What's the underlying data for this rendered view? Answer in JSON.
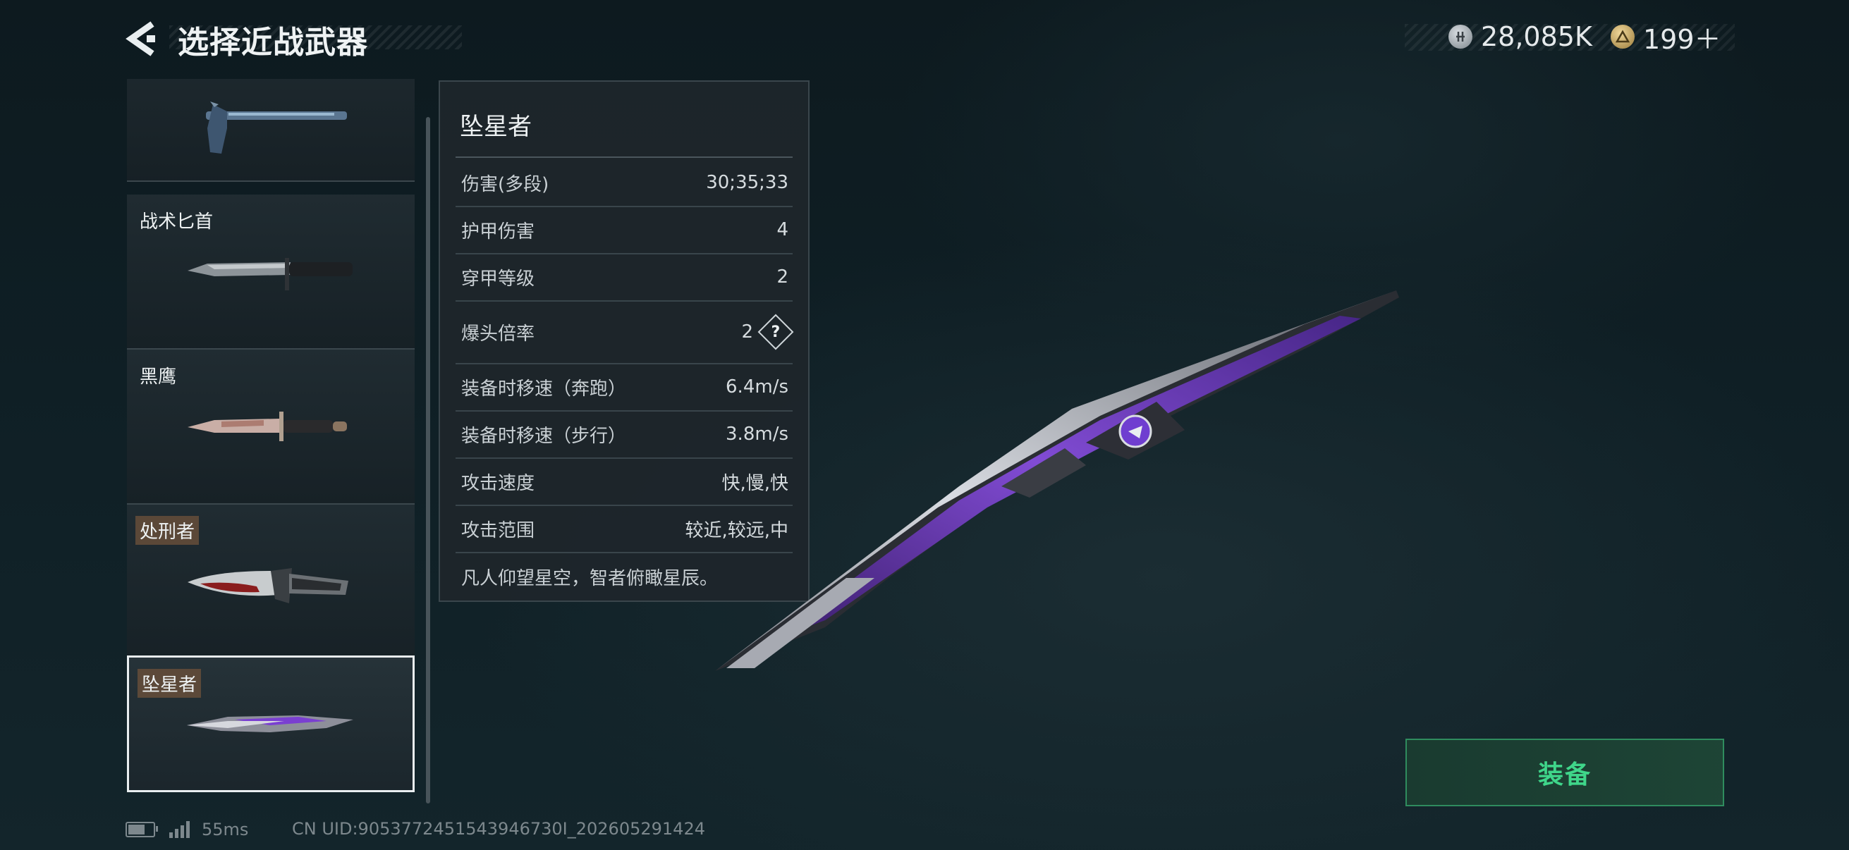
{
  "header": {
    "title": "选择近战武器",
    "currency": [
      {
        "icon": "silver-coin-icon",
        "value": "28,085K"
      },
      {
        "icon": "gold-triangle-coin-icon",
        "value": "199＋"
      }
    ]
  },
  "weapons": [
    {
      "name": "",
      "icon": "tactical-axe-icon",
      "selected": false
    },
    {
      "name": "战术匕首",
      "icon": "tactical-knife-icon",
      "selected": false
    },
    {
      "name": "黑鹰",
      "icon": "black-hawk-knife-icon",
      "selected": false
    },
    {
      "name": "处刑者",
      "icon": "executioner-knife-icon",
      "selected": false
    },
    {
      "name": "坠星者",
      "icon": "star-faller-blade-icon",
      "selected": true
    }
  ],
  "stats": {
    "title": "坠星者",
    "rows": [
      {
        "label": "伤害(多段)",
        "value": "30;35;33"
      },
      {
        "label": "护甲伤害",
        "value": "4"
      },
      {
        "label": "穿甲等级",
        "value": "2"
      },
      {
        "label": "爆头倍率",
        "value": "2",
        "help": "?"
      },
      {
        "label": "装备时移速（奔跑）",
        "value": "6.4m/s"
      },
      {
        "label": "装备时移速（步行）",
        "value": "3.8m/s"
      },
      {
        "label": "攻击速度",
        "value": "快,慢,快"
      },
      {
        "label": "攻击范围",
        "value": "较近,较远,中"
      }
    ],
    "description": "凡人仰望星空，智者俯瞰星辰。"
  },
  "actions": {
    "equip_label": "装备"
  },
  "status_bar": {
    "ping": "55ms",
    "uid": "CN UID:9053772451543946730I_202605291424"
  },
  "colors": {
    "accent_green": "#3fd68a",
    "blade_purple": "#7a3fd1"
  }
}
